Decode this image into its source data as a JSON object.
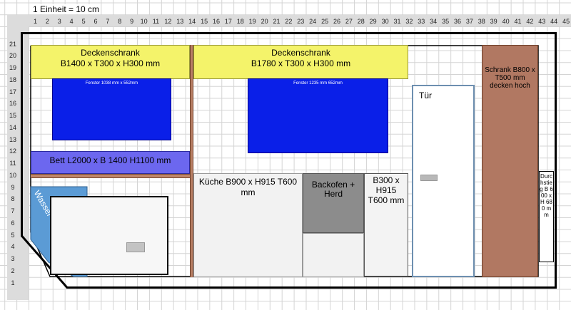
{
  "scale_label": "1 Einheit = 10 cm",
  "ruler": {
    "x_ticks": [
      "1",
      "2",
      "3",
      "4",
      "5",
      "6",
      "7",
      "8",
      "9",
      "10",
      "11",
      "12",
      "13",
      "14",
      "15",
      "16",
      "17",
      "18",
      "19",
      "20",
      "21",
      "22",
      "23",
      "24",
      "25",
      "26",
      "27",
      "28",
      "29",
      "30",
      "31",
      "32",
      "33",
      "34",
      "35",
      "36",
      "37",
      "38",
      "39",
      "40",
      "41",
      "42",
      "43",
      "44",
      "45",
      "46"
    ],
    "y_ticks": [
      "21",
      "20",
      "19",
      "18",
      "17",
      "16",
      "15",
      "14",
      "13",
      "12",
      "11",
      "10",
      "9",
      "8",
      "7",
      "6",
      "5",
      "4",
      "3",
      "2",
      "1"
    ]
  },
  "labels": {
    "cabinet_left": [
      "Deckenschrank",
      "B1400 x T300 x H300 mm"
    ],
    "cabinet_mid": [
      "Deckenschrank",
      "B1780 x T300 x H300 mm"
    ],
    "window_left": "Fenster 1038 mm x 552mm",
    "window_mid": "Fenster 1235 mm 652mm",
    "bed": "Bett L2000 x B 1400 H1100 mm",
    "kitchen": "Küche B900 x H915 T600 mm",
    "oven": [
      "Backofen +",
      "Herd"
    ],
    "b300": [
      "B300 x",
      "H915",
      "T600 mm"
    ],
    "door": "Tür",
    "wardrobe": [
      "Schrank B800  x",
      "T500 mm",
      "decken  hoch"
    ],
    "passage": "Durchstieg B 600 x H 680 mm",
    "water": "Wasser"
  },
  "colors": {
    "cabinet": "#f4f36a",
    "window": "#0a1fe8",
    "bed": "#6c67ef",
    "wood": "#b17862",
    "water": "#5b9bd5",
    "water_light": "#cfe4f5",
    "oven": "#8c8c8c",
    "door_border": "#6d8fb0"
  }
}
